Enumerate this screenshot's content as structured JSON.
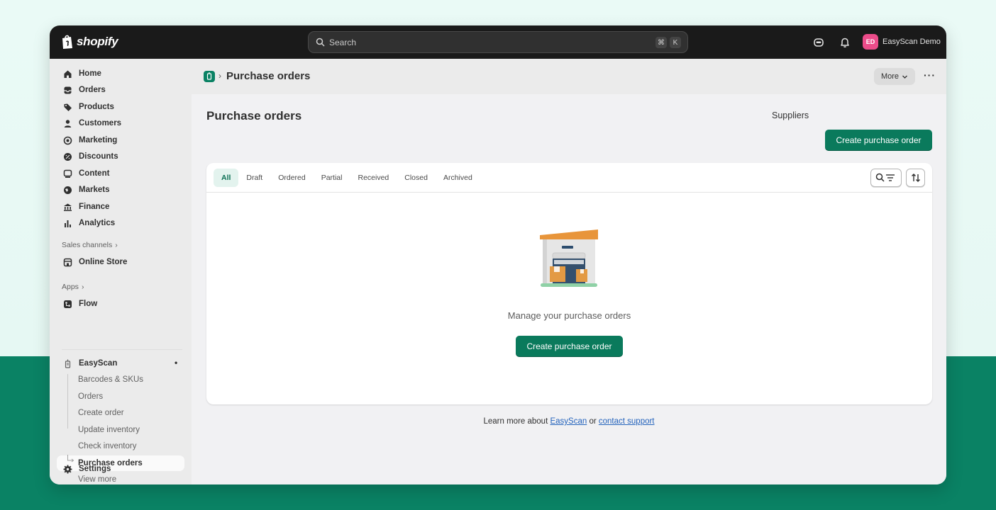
{
  "topbar": {
    "brand": "shopify",
    "search_placeholder": "Search",
    "shortcut_mod": "⌘",
    "shortcut_key": "K",
    "user_initials": "ED",
    "user_name": "EasyScan Demo"
  },
  "sidebar": {
    "items": [
      {
        "label": "Home",
        "icon": "home-icon"
      },
      {
        "label": "Orders",
        "icon": "orders-icon"
      },
      {
        "label": "Products",
        "icon": "tag-icon"
      },
      {
        "label": "Customers",
        "icon": "person-icon"
      },
      {
        "label": "Marketing",
        "icon": "target-icon"
      },
      {
        "label": "Discounts",
        "icon": "discount-icon"
      },
      {
        "label": "Content",
        "icon": "content-icon"
      },
      {
        "label": "Markets",
        "icon": "globe-icon"
      },
      {
        "label": "Finance",
        "icon": "bank-icon"
      },
      {
        "label": "Analytics",
        "icon": "bar-chart-icon"
      }
    ],
    "sales_channels_label": "Sales channels",
    "online_store": "Online Store",
    "apps_label": "Apps",
    "flow": "Flow",
    "easyscan": "EasyScan",
    "easyscan_sub": [
      "Barcodes & SKUs",
      "Orders",
      "Create order",
      "Update inventory",
      "Check inventory",
      "Purchase orders"
    ],
    "view_more": "View more",
    "settings": "Settings"
  },
  "appbar": {
    "title": "Purchase orders",
    "more_label": "More"
  },
  "page": {
    "title": "Purchase orders",
    "suppliers_label": "Suppliers",
    "create_label": "Create purchase order"
  },
  "tabs": [
    "All",
    "Draft",
    "Ordered",
    "Partial",
    "Received",
    "Closed",
    "Archived"
  ],
  "empty_state": {
    "message": "Manage your purchase orders",
    "button_label": "Create purchase order"
  },
  "footer": {
    "prefix": "Learn more about ",
    "link1": "EasyScan",
    "middle": " or ",
    "link2": "contact support"
  },
  "colors": {
    "primary": "#0a7a5c",
    "topbar": "#1a1a1a",
    "background_green": "#0a8264",
    "avatar": "#ec4c8a"
  }
}
